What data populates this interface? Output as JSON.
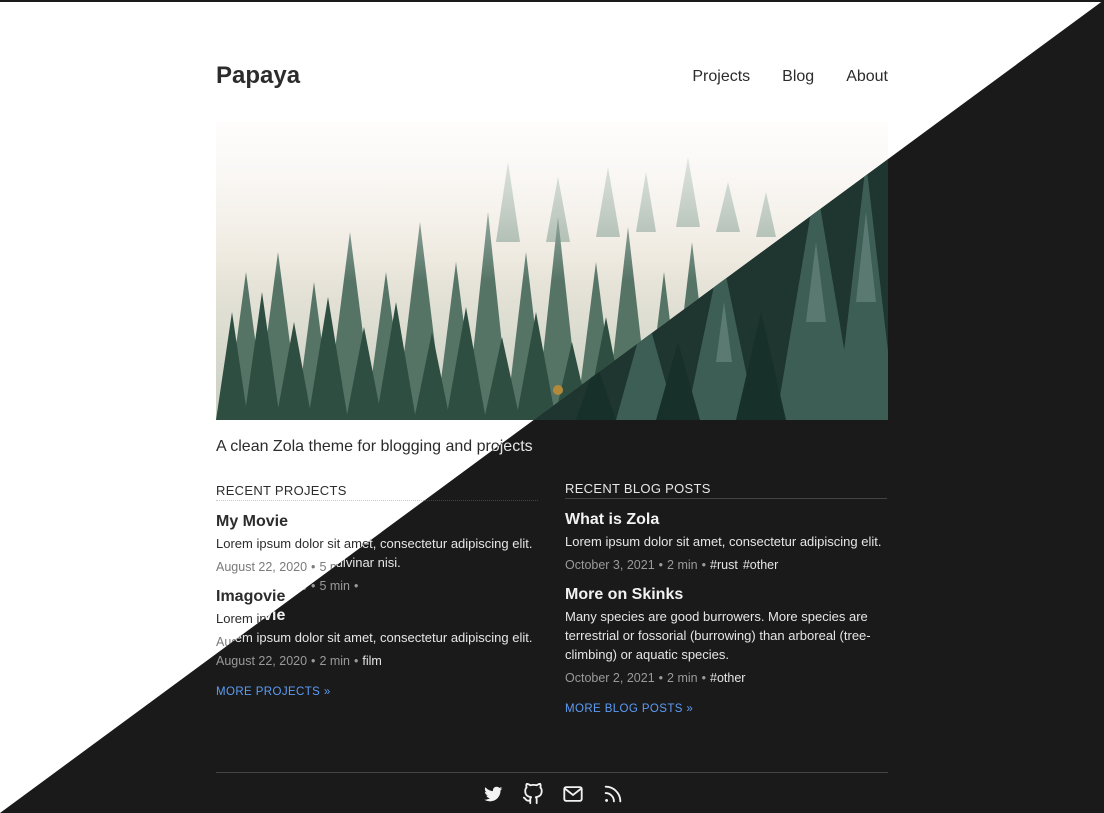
{
  "site": {
    "title": "Papaya",
    "tagline": "A clean Zola theme for blogging and projects"
  },
  "nav": {
    "items": [
      {
        "label": "Projects"
      },
      {
        "label": "Blog"
      },
      {
        "label": "About"
      }
    ]
  },
  "hero": {
    "alt": "Misty pine forest"
  },
  "projects": {
    "heading": "RECENT PROJECTS",
    "items": [
      {
        "title": "My Movie",
        "summary": "Lorem ipsum dolor sit amet, consectetur adipiscing elit.",
        "summary_dark": "Lorem ipsum dolor sit amet, consectetur adipiscing elit. Vivamus vel est, at pulvinar nisi.",
        "date": "August 22, 2020",
        "read_time": "5 min",
        "tags": []
      },
      {
        "title": "Imagovie",
        "summary": "Lorem ipsum dolor sit amet, consectetur adipiscing elit.",
        "date": "August 22, 2020",
        "read_time": "2 min",
        "tags": [
          "film"
        ]
      }
    ],
    "more_label": "MORE PROJECTS »"
  },
  "blog": {
    "heading": "RECENT BLOG POSTS",
    "items": [
      {
        "title": "What is Zola",
        "summary": "Lorem ipsum dolor sit amet, consectetur adipiscing elit.",
        "date": "October 3, 2021",
        "read_time": "2 min",
        "tags": [
          "#rust",
          "#other"
        ]
      },
      {
        "title": "More on Skinks",
        "summary": "Many species are good burrowers. More species are terrestrial or fossorial (burrowing) than arboreal (tree-climbing) or aquatic species.",
        "date": "October 2, 2021",
        "read_time": "2 min",
        "tags": [
          "#other"
        ]
      }
    ],
    "more_label": "MORE BLOG POSTS »"
  },
  "footer": {
    "icons": [
      "twitter-icon",
      "github-icon",
      "email-icon",
      "rss-icon"
    ]
  },
  "colors": {
    "light_bg": "#ffffff",
    "dark_bg": "#1a1a1a",
    "link": "#3b82f6"
  }
}
